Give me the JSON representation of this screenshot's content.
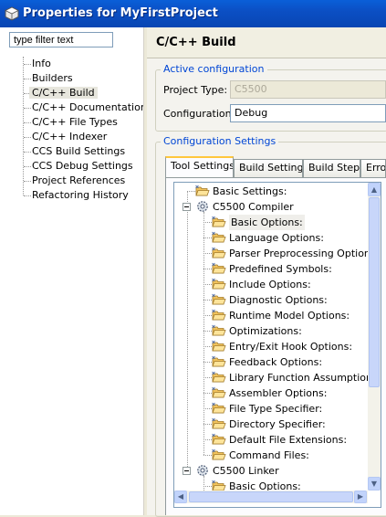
{
  "window": {
    "title": "Properties for MyFirstProject",
    "icon": "properties-icon"
  },
  "filter": {
    "value": "type filter text"
  },
  "left_tree": {
    "items": [
      {
        "label": "Info"
      },
      {
        "label": "Builders"
      },
      {
        "label": "C/C++ Build",
        "selected": true
      },
      {
        "label": "C/C++ Documentation"
      },
      {
        "label": "C/C++ File Types"
      },
      {
        "label": "C/C++ Indexer"
      },
      {
        "label": "CCS Build Settings"
      },
      {
        "label": "CCS Debug Settings"
      },
      {
        "label": "Project References"
      },
      {
        "label": "Refactoring History"
      }
    ]
  },
  "page": {
    "title": "C/C++ Build"
  },
  "active_config": {
    "legend": "Active configuration",
    "project_type_label": "Project Type:",
    "project_type_value": "C5500",
    "configuration_label": "Configuration:",
    "configuration_value": "Debug"
  },
  "config_settings": {
    "legend": "Configuration Settings",
    "tabs": [
      {
        "label": "Tool Settings",
        "active": true
      },
      {
        "label": "Build Settings"
      },
      {
        "label": "Build Steps"
      },
      {
        "label": "Error"
      }
    ]
  },
  "settings_tree": {
    "rows": [
      {
        "label": "Basic Settings:",
        "level": 0
      },
      {
        "label": "C5500 Compiler",
        "level": 0,
        "type": "tool",
        "expanded": true
      },
      {
        "label": "Basic Options:",
        "level": 1,
        "selected": true
      },
      {
        "label": "Language Options:",
        "level": 1
      },
      {
        "label": "Parser Preprocessing Options:",
        "level": 1
      },
      {
        "label": "Predefined Symbols:",
        "level": 1
      },
      {
        "label": "Include Options:",
        "level": 1
      },
      {
        "label": "Diagnostic Options:",
        "level": 1
      },
      {
        "label": "Runtime Model Options:",
        "level": 1
      },
      {
        "label": "Optimizations:",
        "level": 1
      },
      {
        "label": "Entry/Exit Hook Options:",
        "level": 1
      },
      {
        "label": "Feedback Options:",
        "level": 1
      },
      {
        "label": "Library Function Assumptions:",
        "level": 1
      },
      {
        "label": "Assembler Options:",
        "level": 1
      },
      {
        "label": "File Type Specifier:",
        "level": 1
      },
      {
        "label": "Directory Specifier:",
        "level": 1
      },
      {
        "label": "Default File Extensions:",
        "level": 1
      },
      {
        "label": "Command Files:",
        "level": 1
      },
      {
        "label": "C5500 Linker",
        "level": 0,
        "type": "tool",
        "expanded": true
      },
      {
        "label": "Basic Options:",
        "level": 1
      }
    ]
  },
  "colors": {
    "title_bar": "#0a5fd8",
    "accent_text": "#0046d5",
    "folder": "#f2c35b"
  }
}
